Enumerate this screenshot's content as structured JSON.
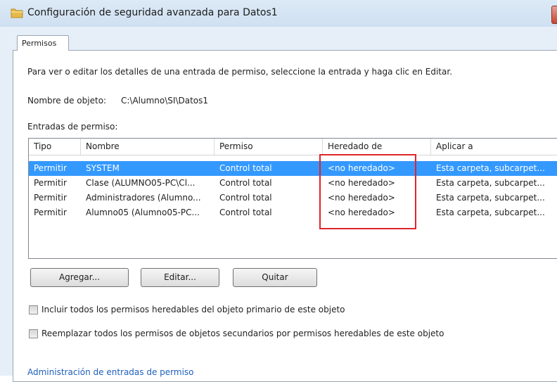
{
  "window": {
    "title": "Configuración de seguridad avanzada para Datos1"
  },
  "tabs": [
    {
      "label": "Permisos"
    }
  ],
  "instructions": "Para ver o editar los detalles de una entrada de permiso, seleccione la entrada y haga clic en Editar.",
  "object": {
    "label": "Nombre de objeto:",
    "value": "C:\\Alumno\\SI\\Datos1"
  },
  "entries_label": "Entradas de permiso:",
  "table": {
    "columns": [
      "Tipo",
      "Nombre",
      "Permiso",
      "Heredado de",
      "Aplicar a"
    ],
    "rows": [
      [
        "Permitir",
        "SYSTEM",
        "Control total",
        "<no heredado>",
        "Esta carpeta, subcarpet..."
      ],
      [
        "Permitir",
        "Clase (ALUMNO05-PC\\Cl...",
        "Control total",
        "<no heredado>",
        "Esta carpeta, subcarpet..."
      ],
      [
        "Permitir",
        "Administradores (Alumno...",
        "Control total",
        "<no heredado>",
        "Esta carpeta, subcarpet..."
      ],
      [
        "Permitir",
        "Alumno05 (Alumno05-PC...",
        "Control total",
        "<no heredado>",
        "Esta carpeta, subcarpet..."
      ]
    ],
    "selected_row": 0
  },
  "buttons": {
    "add": "Agregar...",
    "edit": "Editar...",
    "remove": "Quitar"
  },
  "checkboxes": [
    {
      "label": "Incluir todos los permisos heredables del objeto primario de este objeto",
      "checked": false
    },
    {
      "label": "Reemplazar todos los permisos de objetos secundarios por permisos heredables de este objeto",
      "checked": false
    }
  ],
  "link": "Administración de entradas de permiso",
  "icons": {
    "title": "folder-icon"
  },
  "colors": {
    "selection": "#3399ff",
    "highlight_box": "#e0242b",
    "link": "#1f5fbd"
  }
}
